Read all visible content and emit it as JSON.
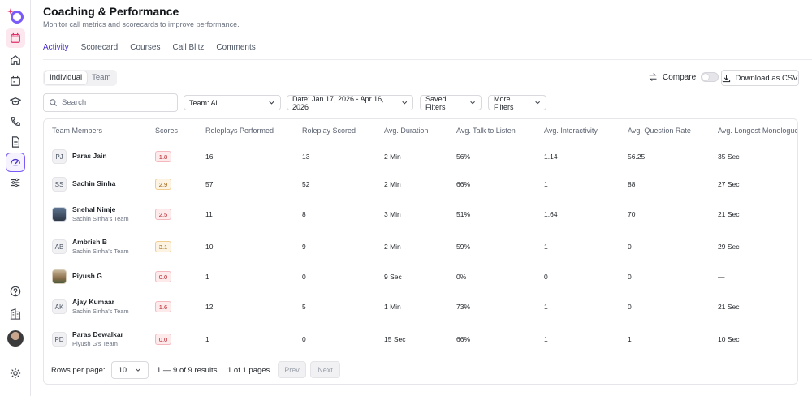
{
  "page": {
    "title": "Coaching & Performance",
    "subtitle": "Monitor call metrics and scorecards to improve performance."
  },
  "tabs": [
    "Activity",
    "Scorecard",
    "Courses",
    "Call Blitz",
    "Comments"
  ],
  "active_tab": "Activity",
  "view_toggle": [
    "Individual",
    "Team"
  ],
  "active_view": "Individual",
  "compare": {
    "label": "Compare",
    "enabled": false
  },
  "download_label": "Download as CSV",
  "search": {
    "placeholder": "Search",
    "value": ""
  },
  "filters": {
    "team": "Team: All",
    "date": "Date: Jan 17, 2026 - Apr 16, 2026",
    "saved": "Saved Filters",
    "more": "More Filters"
  },
  "table": {
    "columns": [
      "Team Members",
      "Scores",
      "Roleplays Performed",
      "Roleplay Scored",
      "Avg. Duration",
      "Avg. Talk to Listen",
      "Avg. Interactivity",
      "Avg. Question Rate",
      "Avg. Longest Monologue"
    ],
    "rows": [
      {
        "initials": "PJ",
        "avatar": "initials",
        "name": "Paras Jain",
        "team": "",
        "score": "1.8",
        "score_color": "red",
        "performed": "16",
        "scored": "13",
        "duration": "2 Min",
        "talk": "56%",
        "interactivity": "1.14",
        "question_rate": "56.25",
        "monologue": "35 Sec"
      },
      {
        "initials": "SS",
        "avatar": "initials",
        "name": "Sachin Sinha",
        "team": "",
        "score": "2.9",
        "score_color": "orange",
        "performed": "57",
        "scored": "52",
        "duration": "2 Min",
        "talk": "66%",
        "interactivity": "1",
        "question_rate": "88",
        "monologue": "27 Sec"
      },
      {
        "initials": "",
        "avatar": "photo1",
        "name": "Snehal Nimje",
        "team": "Sachin Sinha's Team",
        "score": "2.5",
        "score_color": "red",
        "performed": "11",
        "scored": "8",
        "duration": "3 Min",
        "talk": "51%",
        "interactivity": "1.64",
        "question_rate": "70",
        "monologue": "21 Sec"
      },
      {
        "initials": "AB",
        "avatar": "initials",
        "name": "Ambrish B",
        "team": "Sachin Sinha's Team",
        "score": "3.1",
        "score_color": "orange",
        "performed": "10",
        "scored": "9",
        "duration": "2 Min",
        "talk": "59%",
        "interactivity": "1",
        "question_rate": "0",
        "monologue": "29 Sec"
      },
      {
        "initials": "",
        "avatar": "photo2",
        "name": "Piyush G",
        "team": "",
        "score": "0.0",
        "score_color": "red",
        "performed": "1",
        "scored": "0",
        "duration": "9 Sec",
        "talk": "0%",
        "interactivity": "0",
        "question_rate": "0",
        "monologue": "—"
      },
      {
        "initials": "AK",
        "avatar": "initials",
        "name": "Ajay Kumaar",
        "team": "Sachin Sinha's Team",
        "score": "1.6",
        "score_color": "red",
        "performed": "12",
        "scored": "5",
        "duration": "1 Min",
        "talk": "73%",
        "interactivity": "1",
        "question_rate": "0",
        "monologue": "21 Sec"
      },
      {
        "initials": "PD",
        "avatar": "initials",
        "name": "Paras Dewalkar",
        "team": "Piyush G's Team",
        "score": "0.0",
        "score_color": "red",
        "performed": "1",
        "scored": "0",
        "duration": "15 Sec",
        "talk": "66%",
        "interactivity": "1",
        "question_rate": "1",
        "monologue": "10 Sec"
      }
    ]
  },
  "pagination": {
    "rows_label": "Rows per page:",
    "rows_value": "10",
    "results": "1 — 9 of 9 results",
    "pages": "1 of 1 pages",
    "prev": "Prev",
    "next": "Next"
  },
  "sidebar": {
    "icons": [
      "logo-icon",
      "calendar-icon",
      "home-icon",
      "schedule-icon",
      "courses-icon",
      "phone-icon",
      "document-icon",
      "coaching-icon",
      "sliders-icon",
      "help-icon",
      "building-icon",
      "user-avatar",
      "settings-icon"
    ]
  },
  "colors": {
    "accent": "#4b2ec9",
    "score_red": "#b4232c",
    "score_orange": "#9a5b05"
  }
}
